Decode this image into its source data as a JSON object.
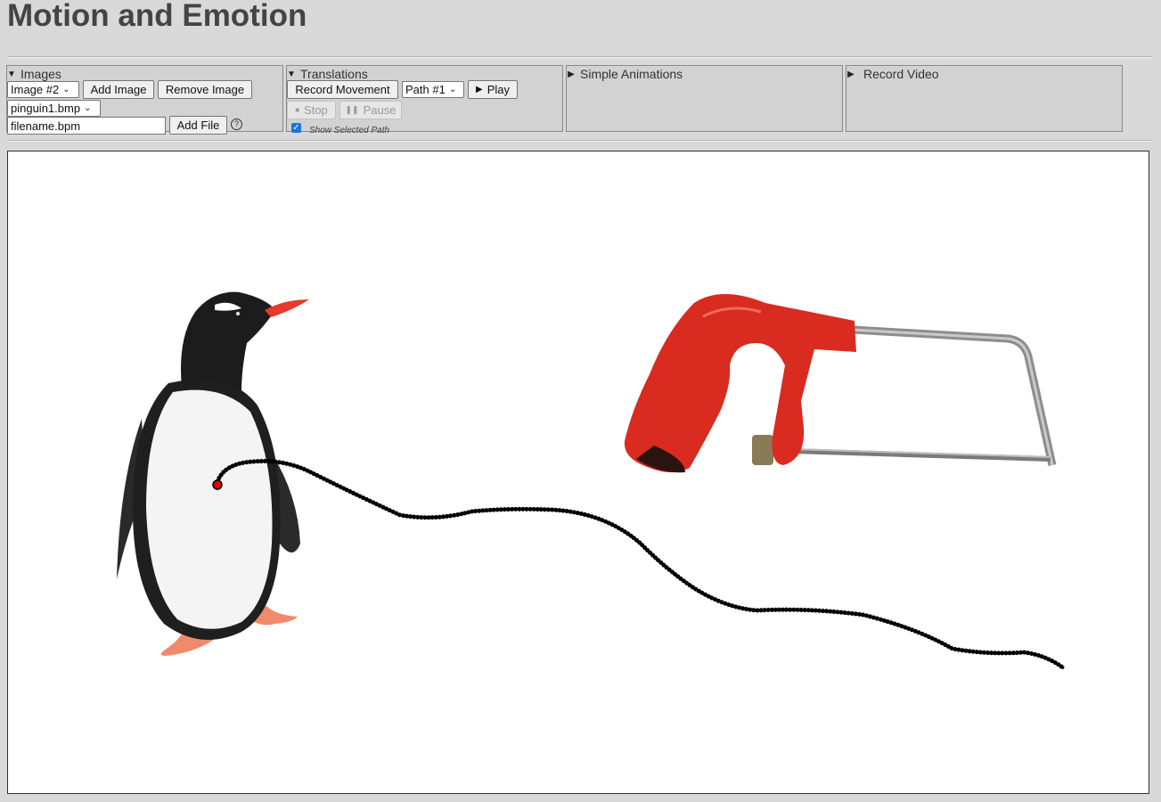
{
  "title": "Motion and Emotion",
  "panels": {
    "images": {
      "label": "Images",
      "expanded": true,
      "image_select": "Image #2",
      "add_image": "Add Image",
      "remove_image": "Remove Image",
      "file_select": "pinguin1.bmp",
      "filename_value": "filename.bpm",
      "add_file": "Add File",
      "help": "?"
    },
    "translations": {
      "label": "Translations",
      "expanded": true,
      "record_movement": "Record Movement",
      "path_select": "Path #1",
      "play": "Play",
      "stop": "Stop",
      "pause": "Pause",
      "show_selected_path": "Show Selected Path",
      "show_selected_path_checked": true
    },
    "simple_animations": {
      "label": "Simple Animations",
      "expanded": false
    },
    "record_video": {
      "label": "Record Video",
      "expanded": false
    }
  },
  "icons": {
    "expanded": "triangle-down-icon",
    "collapsed": "triangle-right-icon",
    "play": "play-icon",
    "stop": "stop-icon",
    "pause": "pause-icon",
    "help": "help-icon",
    "checkbox": "checkmark-icon"
  },
  "colors": {
    "page_bg": "#d9d9d9",
    "panel_bg": "#d2d2d2",
    "canvas_bg": "#ffffff",
    "path_color": "#000000",
    "path_start_color": "#e00000",
    "saw_handle": "#d92b1f",
    "saw_frame": "#9a9a9a",
    "checkbox_accent": "#1a73e8"
  },
  "canvas": {
    "images": [
      "pinguin1.bmp",
      "hacksaw"
    ],
    "path": "Path #1"
  }
}
